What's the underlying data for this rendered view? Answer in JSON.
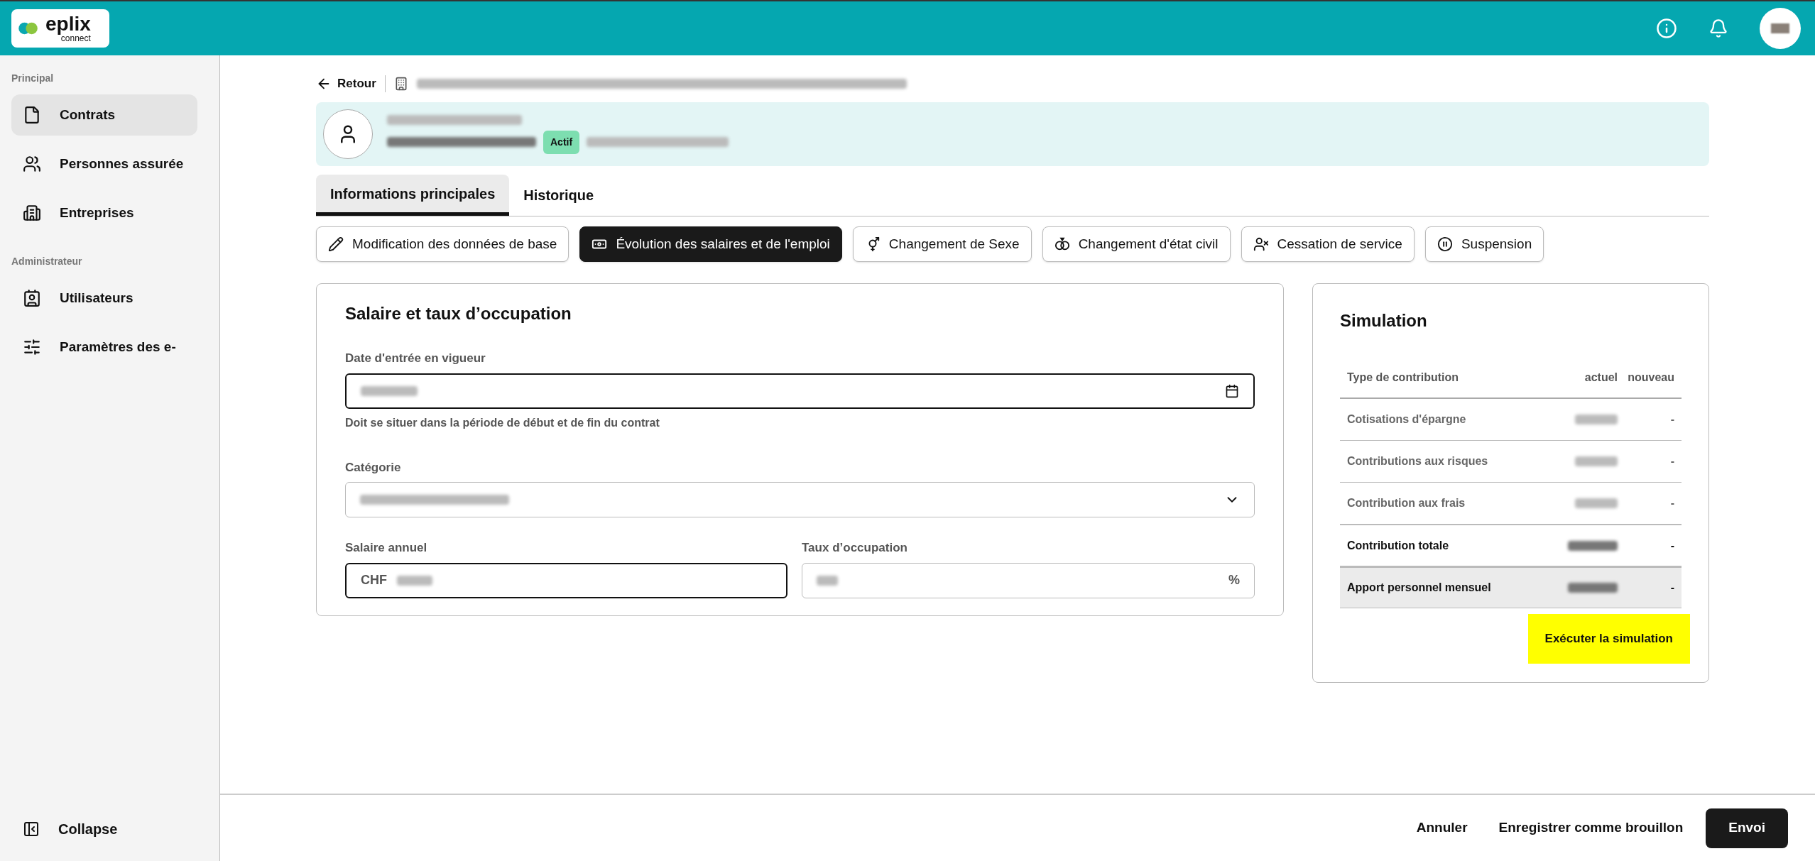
{
  "logo": {
    "name": "eplix",
    "tagline": "connect"
  },
  "sidebar": {
    "sections": [
      {
        "title": "Principal",
        "items": [
          {
            "label": "Contrats",
            "selected": true
          },
          {
            "label": "Personnes assurée",
            "selected": false
          },
          {
            "label": "Entreprises",
            "selected": false
          }
        ]
      },
      {
        "title": "Administrateur",
        "items": [
          {
            "label": "Utilisateurs",
            "selected": false
          },
          {
            "label": "Paramètres des e-",
            "selected": false
          }
        ]
      }
    ],
    "collapse": "Collapse"
  },
  "back": "Retour",
  "profile": {
    "status": "Actif"
  },
  "tabs": [
    {
      "label": "Informations principales",
      "selected": true
    },
    {
      "label": "Historique",
      "selected": false
    }
  ],
  "actions": [
    {
      "label": "Modification des données de base",
      "selected": false
    },
    {
      "label": "Évolution des salaires et de l'emploi",
      "selected": true
    },
    {
      "label": "Changement de Sexe",
      "selected": false
    },
    {
      "label": "Changement d'état civil",
      "selected": false
    },
    {
      "label": "Cessation de service",
      "selected": false
    },
    {
      "label": "Suspension",
      "selected": false
    }
  ],
  "form": {
    "title": "Salaire et taux d’occupation",
    "date_label": "Date d'entrée en vigueur",
    "date_hint": "Doit se situer dans la période de début et de fin du contrat",
    "category_label": "Catégorie",
    "salary_label": "Salaire annuel",
    "salary_prefix": "CHF",
    "rate_label": "Taux d’occupation",
    "rate_suffix": "%"
  },
  "simulation": {
    "title": "Simulation",
    "columns": [
      "Type de contribution",
      "actuel",
      "nouveau"
    ],
    "rows": [
      {
        "kind": "normal",
        "label": "Cotisations d'épargne",
        "new": "-"
      },
      {
        "kind": "normal",
        "label": "Contributions aux risques",
        "new": "-"
      },
      {
        "kind": "normal",
        "label": "Contribution aux frais",
        "new": "-"
      },
      {
        "kind": "total",
        "label": "Contribution totale",
        "new": "-"
      },
      {
        "kind": "highlight",
        "label": "Apport personnel mensuel",
        "new": "-"
      }
    ],
    "button": "Exécuter la simulation"
  },
  "footer": {
    "cancel": "Annuler",
    "draft": "Enregistrer comme brouillon",
    "submit": "Envoi"
  }
}
